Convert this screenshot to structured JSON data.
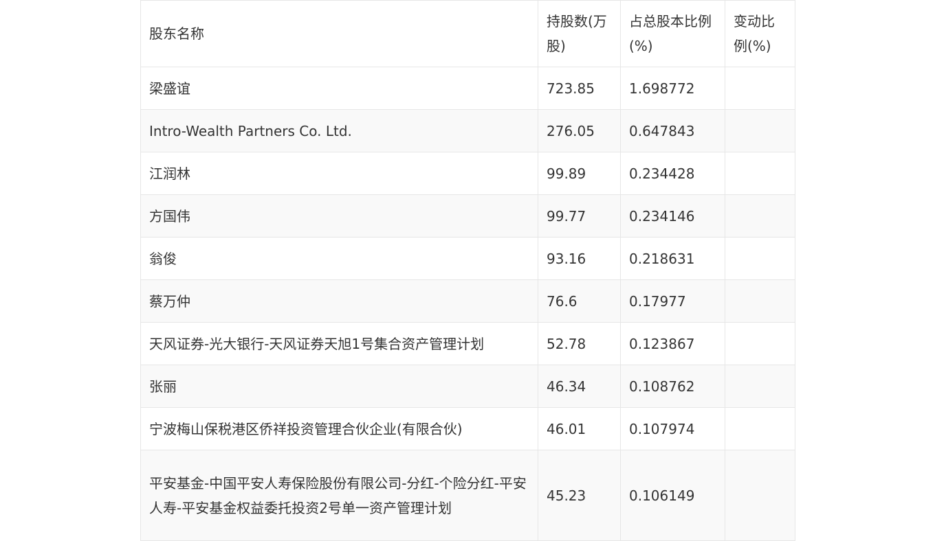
{
  "table": {
    "headers": [
      "股东名称",
      "持股数(万股)",
      "占总股本比例(%)",
      "变动比例(%)"
    ],
    "rows": [
      [
        "梁盛谊",
        "723.85",
        "1.698772",
        ""
      ],
      [
        "Intro-Wealth Partners Co. Ltd.",
        "276.05",
        "0.647843",
        ""
      ],
      [
        "江润林",
        "99.89",
        "0.234428",
        ""
      ],
      [
        "方国伟",
        "99.77",
        "0.234146",
        ""
      ],
      [
        "翁俊",
        "93.16",
        "0.218631",
        ""
      ],
      [
        "蔡万仲",
        "76.6",
        "0.17977",
        ""
      ],
      [
        "天风证券-光大银行-天风证券天旭1号集合资产管理计划",
        "52.78",
        "0.123867",
        ""
      ],
      [
        "张丽",
        "46.34",
        "0.108762",
        ""
      ],
      [
        "宁波梅山保税港区侨祥投资管理合伙企业(有限合伙)",
        "46.01",
        "0.107974",
        ""
      ],
      [
        "平安基金-中国平安人寿保险股份有限公司-分红-个险分红-平安人寿-平安基金权益委托投资2号单一资产管理计划",
        "45.23",
        "0.106149",
        ""
      ]
    ]
  }
}
